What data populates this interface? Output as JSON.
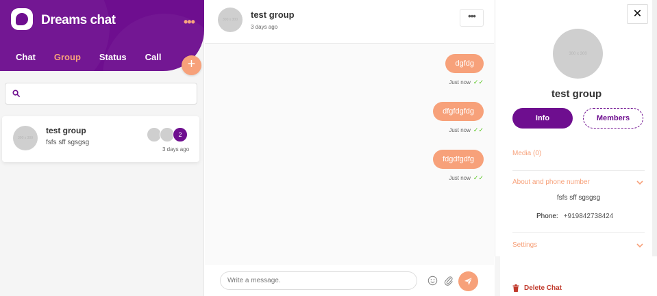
{
  "app": {
    "brand": "Dreams chat",
    "menu_dots": "•••"
  },
  "colors": {
    "primary": "#6e0e8f",
    "accent": "#f7a17a",
    "read_tick": "#52c41a",
    "danger": "#c0392b"
  },
  "sidebar": {
    "tabs": [
      {
        "label": "Chat",
        "active": false
      },
      {
        "label": "Group",
        "active": true
      },
      {
        "label": "Status",
        "active": false
      },
      {
        "label": "Call",
        "active": false
      }
    ],
    "add_label": "+",
    "search": {
      "placeholder": "",
      "value": ""
    },
    "groups": [
      {
        "name": "test group",
        "last_message": "fsfs sff sgsgsg",
        "time": "3 days ago",
        "unread": "2",
        "avatar_text": "300 x 300"
      }
    ]
  },
  "chat": {
    "title": "test group",
    "subtitle": "3 days ago",
    "avatar_text": "300 x 300",
    "more_label": "•••",
    "messages": [
      {
        "text": "dgfdg",
        "time": "Just now",
        "status": "✓✓"
      },
      {
        "text": "dfgfdgfdg",
        "time": "Just now",
        "status": "✓✓"
      },
      {
        "text": "fdgdfgdfg",
        "time": "Just now",
        "status": "✓✓"
      }
    ],
    "composer": {
      "placeholder": "Write a message."
    }
  },
  "details": {
    "close_label": "✕",
    "avatar_text": "300 x 300",
    "name": "test group",
    "info_label": "Info",
    "members_label": "Members",
    "media_label": "Media (0)",
    "about_label": "About and phone number",
    "about_text": "fsfs sff sgsgsg",
    "phone_key": "Phone:",
    "phone_value": "+919842738424",
    "settings_label": "Settings",
    "delete_label": "Delete Chat"
  }
}
